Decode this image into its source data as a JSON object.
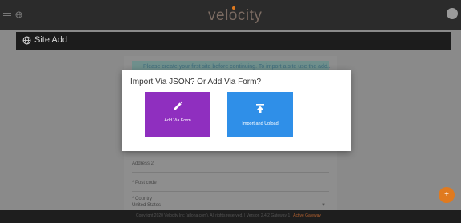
{
  "app": {
    "brand": "velocity"
  },
  "header": {
    "title": "Site Add"
  },
  "form": {
    "info_banner": "Please create your first site before continuing. To import a site use the add...",
    "address2_label": "Address 2",
    "post_code_label": "* Post code",
    "country_label": "* Country",
    "country_value": "United States"
  },
  "footer": {
    "copyright": "Copyright 2020 Velocity Inc (atlona.com). All rights reserved. | Version 2.4.2 ",
    "gateway": "Gateway 1",
    "status": "Active Gateway"
  },
  "dialog": {
    "title": "Import Via JSON? Or Add Via Form?",
    "add_form_label": "Add Via Form",
    "import_label": "Import and Upload"
  },
  "fab": {
    "label": "+"
  },
  "colors": {
    "topbar": "#2b2b2b",
    "accent_orange": "#e07a1f",
    "form_button": "#8f2fbf",
    "import_button": "#2f8fe8",
    "overlay": "#8a8a8a"
  },
  "icons": {
    "menu": "menu-icon",
    "globe": "globe-icon",
    "pencil": "pencil-icon",
    "upload": "upload-icon",
    "user": "user-avatar-icon",
    "add": "plus-icon"
  }
}
